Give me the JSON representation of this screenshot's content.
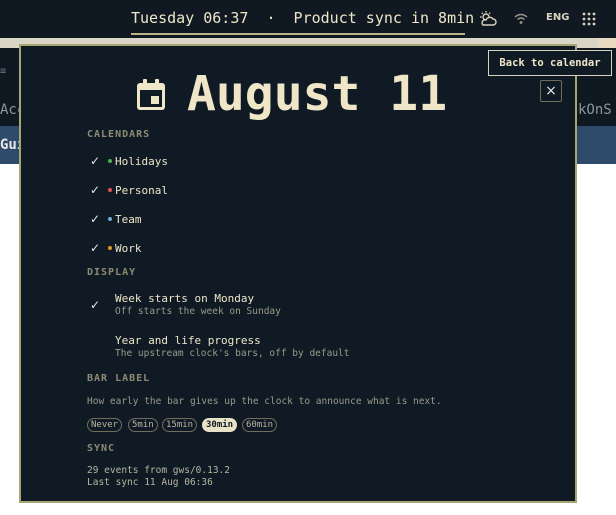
{
  "topbar": {
    "clock_text": "Tuesday 06:37  ·  Product sync in 8min",
    "language": "ENG",
    "icons": [
      "weather-icon",
      "network-icon",
      "apps-grid-icon"
    ]
  },
  "background": {
    "left_fragment_1": "Acco",
    "left_fragment_2": "Gui",
    "right_fragment": "kOnS"
  },
  "modal": {
    "date_title": "August 11",
    "close_glyph": "×",
    "sections": {
      "calendars": "CALENDARS",
      "display": "DISPLAY",
      "bar_label": "BAR LABEL",
      "sync": "SYNC"
    },
    "calendars": [
      {
        "label": "Holidays",
        "checked": true,
        "color": "#4caf50"
      },
      {
        "label": "Personal",
        "checked": true,
        "color": "#e05555"
      },
      {
        "label": "Team",
        "checked": true,
        "color": "#6aaed6"
      },
      {
        "label": "Work",
        "checked": true,
        "color": "#e0962f"
      }
    ],
    "display_options": [
      {
        "title": "Week starts on Monday",
        "subtitle": "Off starts the week on Sunday",
        "checked": true
      },
      {
        "title": "Year and life progress",
        "subtitle": "The upstream clock's bars, off by default",
        "checked": false
      }
    ],
    "bar_label_description": "How early the bar gives up the clock to announce what is next.",
    "bar_label_options": [
      "Never",
      "5min",
      "15min",
      "30min",
      "60min"
    ],
    "bar_label_selected": "30min",
    "sync_lines": [
      "29 events from gws/0.13.2",
      "Last sync 11 Aug 06:36"
    ],
    "check_glyph": "✓"
  },
  "back_button": "Back to calendar",
  "colors": {
    "panel_bg": "#0f1a24",
    "border": "#a7a571",
    "text": "#efe6c8",
    "muted": "#9a9a8a"
  }
}
